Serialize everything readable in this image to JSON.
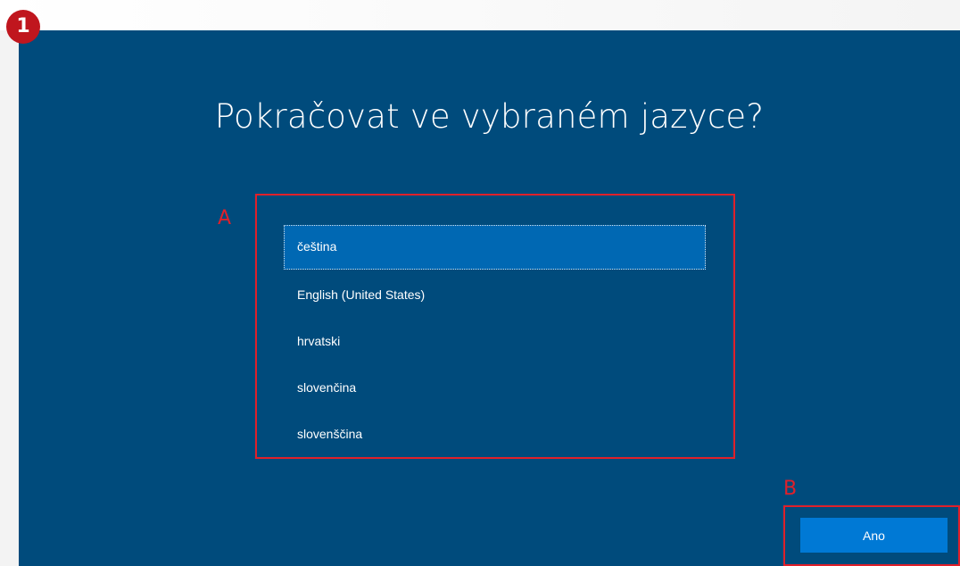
{
  "badge": {
    "number": "1"
  },
  "annotations": {
    "a": "A",
    "b": "B"
  },
  "title": "Pokračovat ve vybraném jazyce?",
  "languages": [
    {
      "label": "čeština",
      "selected": true
    },
    {
      "label": "English (United States)",
      "selected": false
    },
    {
      "label": "hrvatski",
      "selected": false
    },
    {
      "label": "slovenčina",
      "selected": false
    },
    {
      "label": "slovenščina",
      "selected": false
    }
  ],
  "yes_button": {
    "label": "Ano"
  },
  "colors": {
    "background": "#004b7c",
    "selected_item": "#0068b3",
    "button": "#0079d5",
    "annotation": "#e0202a",
    "badge": "#c0161e"
  }
}
